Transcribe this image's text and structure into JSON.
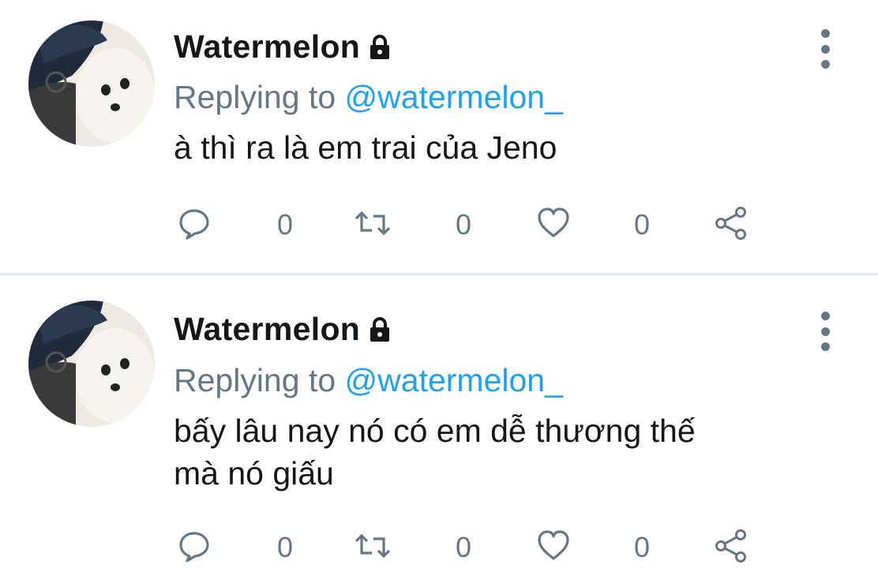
{
  "tweets": [
    {
      "author_name": "Watermelon",
      "replying_label": "Replying to",
      "replying_handle": "@watermelon_",
      "text_lines": [
        "à thì ra là em trai của Jeno"
      ],
      "reply_count": "0",
      "retweet_count": "0",
      "like_count": "0",
      "icons": {
        "lock": "lock-icon",
        "more": "more-vertical-icon",
        "reply": "reply-icon",
        "retweet": "retweet-icon",
        "like": "heart-icon",
        "share": "share-icon"
      }
    },
    {
      "author_name": "Watermelon",
      "replying_label": "Replying to",
      "replying_handle": "@watermelon_",
      "text_lines": [
        "bấy lâu nay nó có em dễ thương thế",
        "mà nó giấu"
      ],
      "reply_count": "0",
      "retweet_count": "0",
      "like_count": "0",
      "icons": {
        "lock": "lock-icon",
        "more": "more-vertical-icon",
        "reply": "reply-icon",
        "retweet": "retweet-icon",
        "like": "heart-icon",
        "share": "share-icon"
      }
    }
  ],
  "colors": {
    "link": "#1da1f2",
    "muted": "#657786",
    "text": "#14171a",
    "divider": "#e1e8ed"
  }
}
